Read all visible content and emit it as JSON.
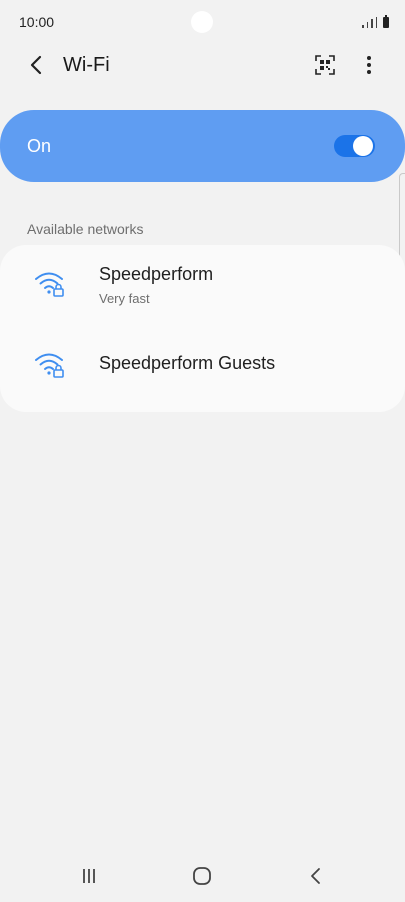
{
  "status_bar": {
    "time": "10:00"
  },
  "header": {
    "title": "Wi-Fi",
    "icons": {
      "back": "back-arrow-icon",
      "qr": "qr-code-scanner-icon",
      "more": "more-options-icon"
    }
  },
  "master_switch": {
    "label": "On",
    "state": true,
    "accent_color": "#5f9df2",
    "toggle_color": "#1b73e8"
  },
  "available_networks": {
    "header": "Available networks",
    "items": [
      {
        "name": "Speedperform",
        "status": "Very fast",
        "icon": "wifi-secured-icon"
      },
      {
        "name": "Speedperform Guests",
        "status": "",
        "icon": "wifi-secured-icon"
      }
    ]
  },
  "nav_bar": {
    "icons": [
      "recents-icon",
      "home-icon",
      "back-icon"
    ]
  }
}
